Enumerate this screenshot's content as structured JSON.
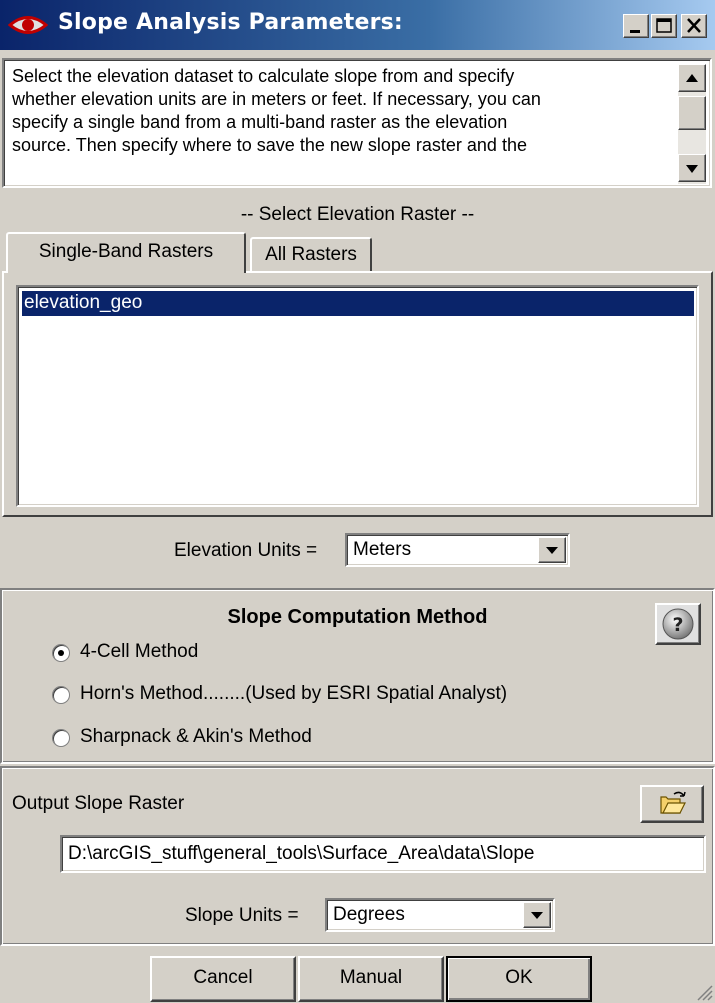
{
  "window": {
    "title": "Slope Analysis Parameters:",
    "controls": [
      "minimize-icon",
      "maximize-icon",
      "close-icon"
    ]
  },
  "description": {
    "lines": [
      "Select the elevation dataset to calculate slope from and specify",
      "whether elevation units are in meters or feet. If necessary, you can",
      "specify a single band from a multi-band raster as the elevation",
      "source. Then specify where to save the new slope raster and the"
    ]
  },
  "elevation_section": {
    "heading": "-- Select Elevation Raster --",
    "tabs": [
      {
        "label": "Single-Band Rasters",
        "active": true
      },
      {
        "label": "All Rasters",
        "active": false
      }
    ],
    "rasters": [
      "elevation_geo"
    ],
    "selected_raster": "elevation_geo",
    "units_label": "Elevation Units =",
    "units_value": "Meters"
  },
  "method_section": {
    "heading": "Slope Computation Method",
    "help_icon": "help-icon",
    "options": [
      {
        "label": "4-Cell Method",
        "selected": true
      },
      {
        "label": "Horn's Method........(Used by ESRI Spatial Analyst)",
        "selected": false
      },
      {
        "label": "Sharpnack & Akin's Method",
        "selected": false
      }
    ]
  },
  "output_section": {
    "label": "Output Slope Raster",
    "path": "D:\\arcGIS_stuff\\general_tools\\Surface_Area\\data\\Slope",
    "browse_icon": "open-folder-icon",
    "slope_units_label": "Slope Units =",
    "slope_units_value": "Degrees"
  },
  "buttons": {
    "cancel": "Cancel",
    "manual": "Manual",
    "ok": "OK"
  },
  "colors": {
    "titlebar_start": "#0a246a",
    "titlebar_end": "#a6caf0",
    "selection": "#0a246a",
    "face": "#d4d0c8"
  }
}
